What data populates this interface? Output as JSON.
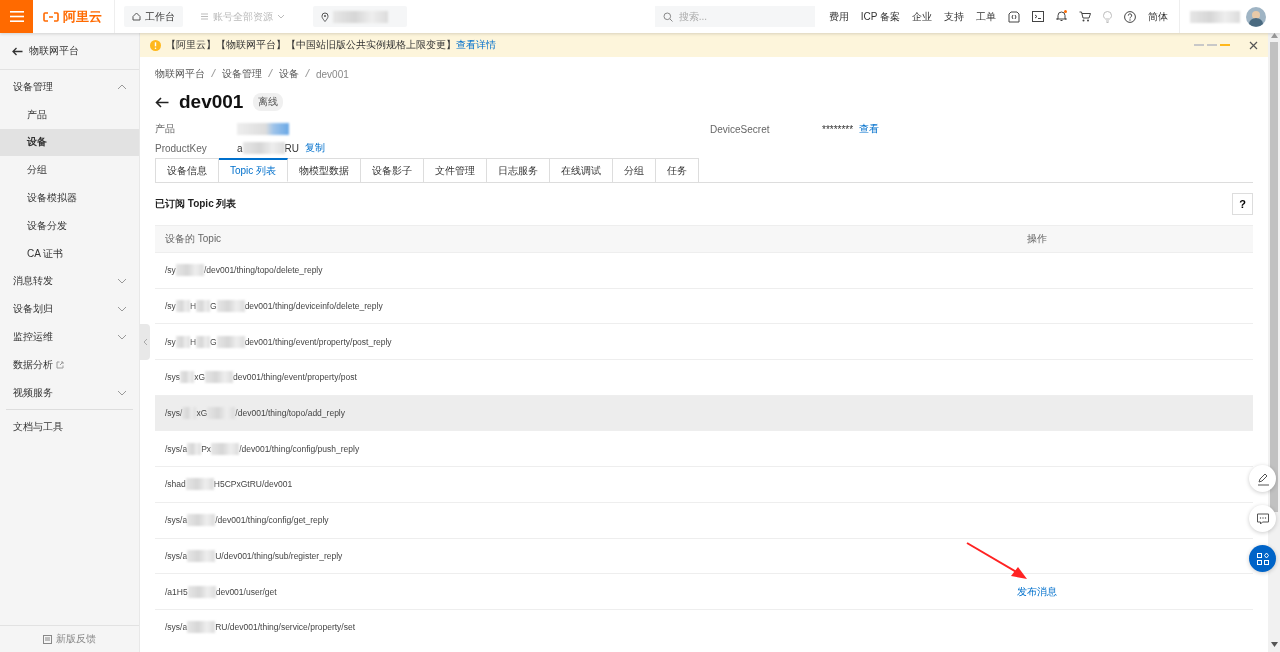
{
  "topbar": {
    "logo": "阿里云",
    "workbench": "工作台",
    "resources": "账号全部资源",
    "search_placeholder": "搜索...",
    "links": [
      "费用",
      "ICP 备案",
      "企业",
      "支持",
      "工单"
    ],
    "language": "简体"
  },
  "sidebar": {
    "back": "物联网平台",
    "items": [
      {
        "label": "设备管理",
        "kind": "group",
        "expanded": true,
        "children": [
          {
            "label": "产品",
            "selected": false
          },
          {
            "label": "设备",
            "selected": true
          },
          {
            "label": "分组",
            "selected": false
          },
          {
            "label": "设备模拟器",
            "selected": false
          },
          {
            "label": "设备分发",
            "selected": false
          },
          {
            "label": "CA 证书",
            "selected": false
          }
        ]
      },
      {
        "label": "消息转发",
        "kind": "group",
        "expanded": false
      },
      {
        "label": "设备划归",
        "kind": "group",
        "expanded": false
      },
      {
        "label": "监控运维",
        "kind": "group",
        "expanded": false
      },
      {
        "label": "数据分析",
        "kind": "external"
      },
      {
        "label": "视频服务",
        "kind": "group",
        "expanded": false
      }
    ],
    "tools": "文档与工具",
    "feedback": "新版反馈"
  },
  "notice": {
    "text": "【阿里云】【物联网平台】【中国站旧版公共实例规格上限变更】",
    "link": "查看详情",
    "pager": [
      {
        "selected": false
      },
      {
        "selected": false
      },
      {
        "selected": true
      }
    ]
  },
  "breadcrumb": [
    "物联网平台",
    "设备管理",
    "设备",
    "dev001"
  ],
  "device": {
    "name": "dev001",
    "status": "离线"
  },
  "fields": {
    "product_label": "产品",
    "product_key_label": "ProductKey",
    "product_key": [
      "a",
      "RU"
    ],
    "copy": "复制",
    "secret_label": "DeviceSecret",
    "secret": "********",
    "view": "查看"
  },
  "tabs": [
    {
      "label": "设备信息",
      "selected": false
    },
    {
      "label": "Topic 列表",
      "selected": true
    },
    {
      "label": "物模型数据",
      "selected": false
    },
    {
      "label": "设备影子",
      "selected": false
    },
    {
      "label": "文件管理",
      "selected": false
    },
    {
      "label": "日志服务",
      "selected": false
    },
    {
      "label": "在线调试",
      "selected": false
    },
    {
      "label": "分组",
      "selected": false
    },
    {
      "label": "任务",
      "selected": false
    }
  ],
  "section_title": "已订阅 Topic 列表",
  "help": "?",
  "table": {
    "columns": [
      "设备的 Topic",
      "操作"
    ],
    "rows": [
      {
        "topic": [
          "/sy",
          "/dev001/thing/topo/delete_reply"
        ],
        "highlighted": false
      },
      {
        "topic": [
          "/sy",
          "H",
          "G",
          "dev001/thing/deviceinfo/delete_reply"
        ],
        "highlighted": false
      },
      {
        "topic": [
          "/sy",
          "H",
          "G",
          "dev001/thing/event/property/post_reply"
        ],
        "highlighted": false
      },
      {
        "topic": [
          "/sys",
          "xG",
          "dev001/thing/event/property/post"
        ],
        "highlighted": false
      },
      {
        "topic": [
          "/sys/",
          "xG",
          "/dev001/thing/topo/add_reply"
        ],
        "highlighted": true
      },
      {
        "topic": [
          "/sys/a",
          "Px",
          "/dev001/thing/config/push_reply"
        ],
        "highlighted": false
      },
      {
        "topic": [
          "/shad",
          "H5CPxGtRU/dev001"
        ],
        "highlighted": false
      },
      {
        "topic": [
          "/sys/a",
          "/dev001/thing/config/get_reply"
        ],
        "highlighted": false
      },
      {
        "topic": [
          "/sys/a",
          "U/dev001/thing/sub/register_reply"
        ],
        "highlighted": false
      },
      {
        "topic": [
          "/a1H5",
          "dev001/user/get"
        ],
        "highlighted": false,
        "action": "发布消息"
      },
      {
        "topic": [
          "/sys/a",
          "RU/dev001/thing/service/property/set"
        ],
        "highlighted": false
      }
    ]
  }
}
